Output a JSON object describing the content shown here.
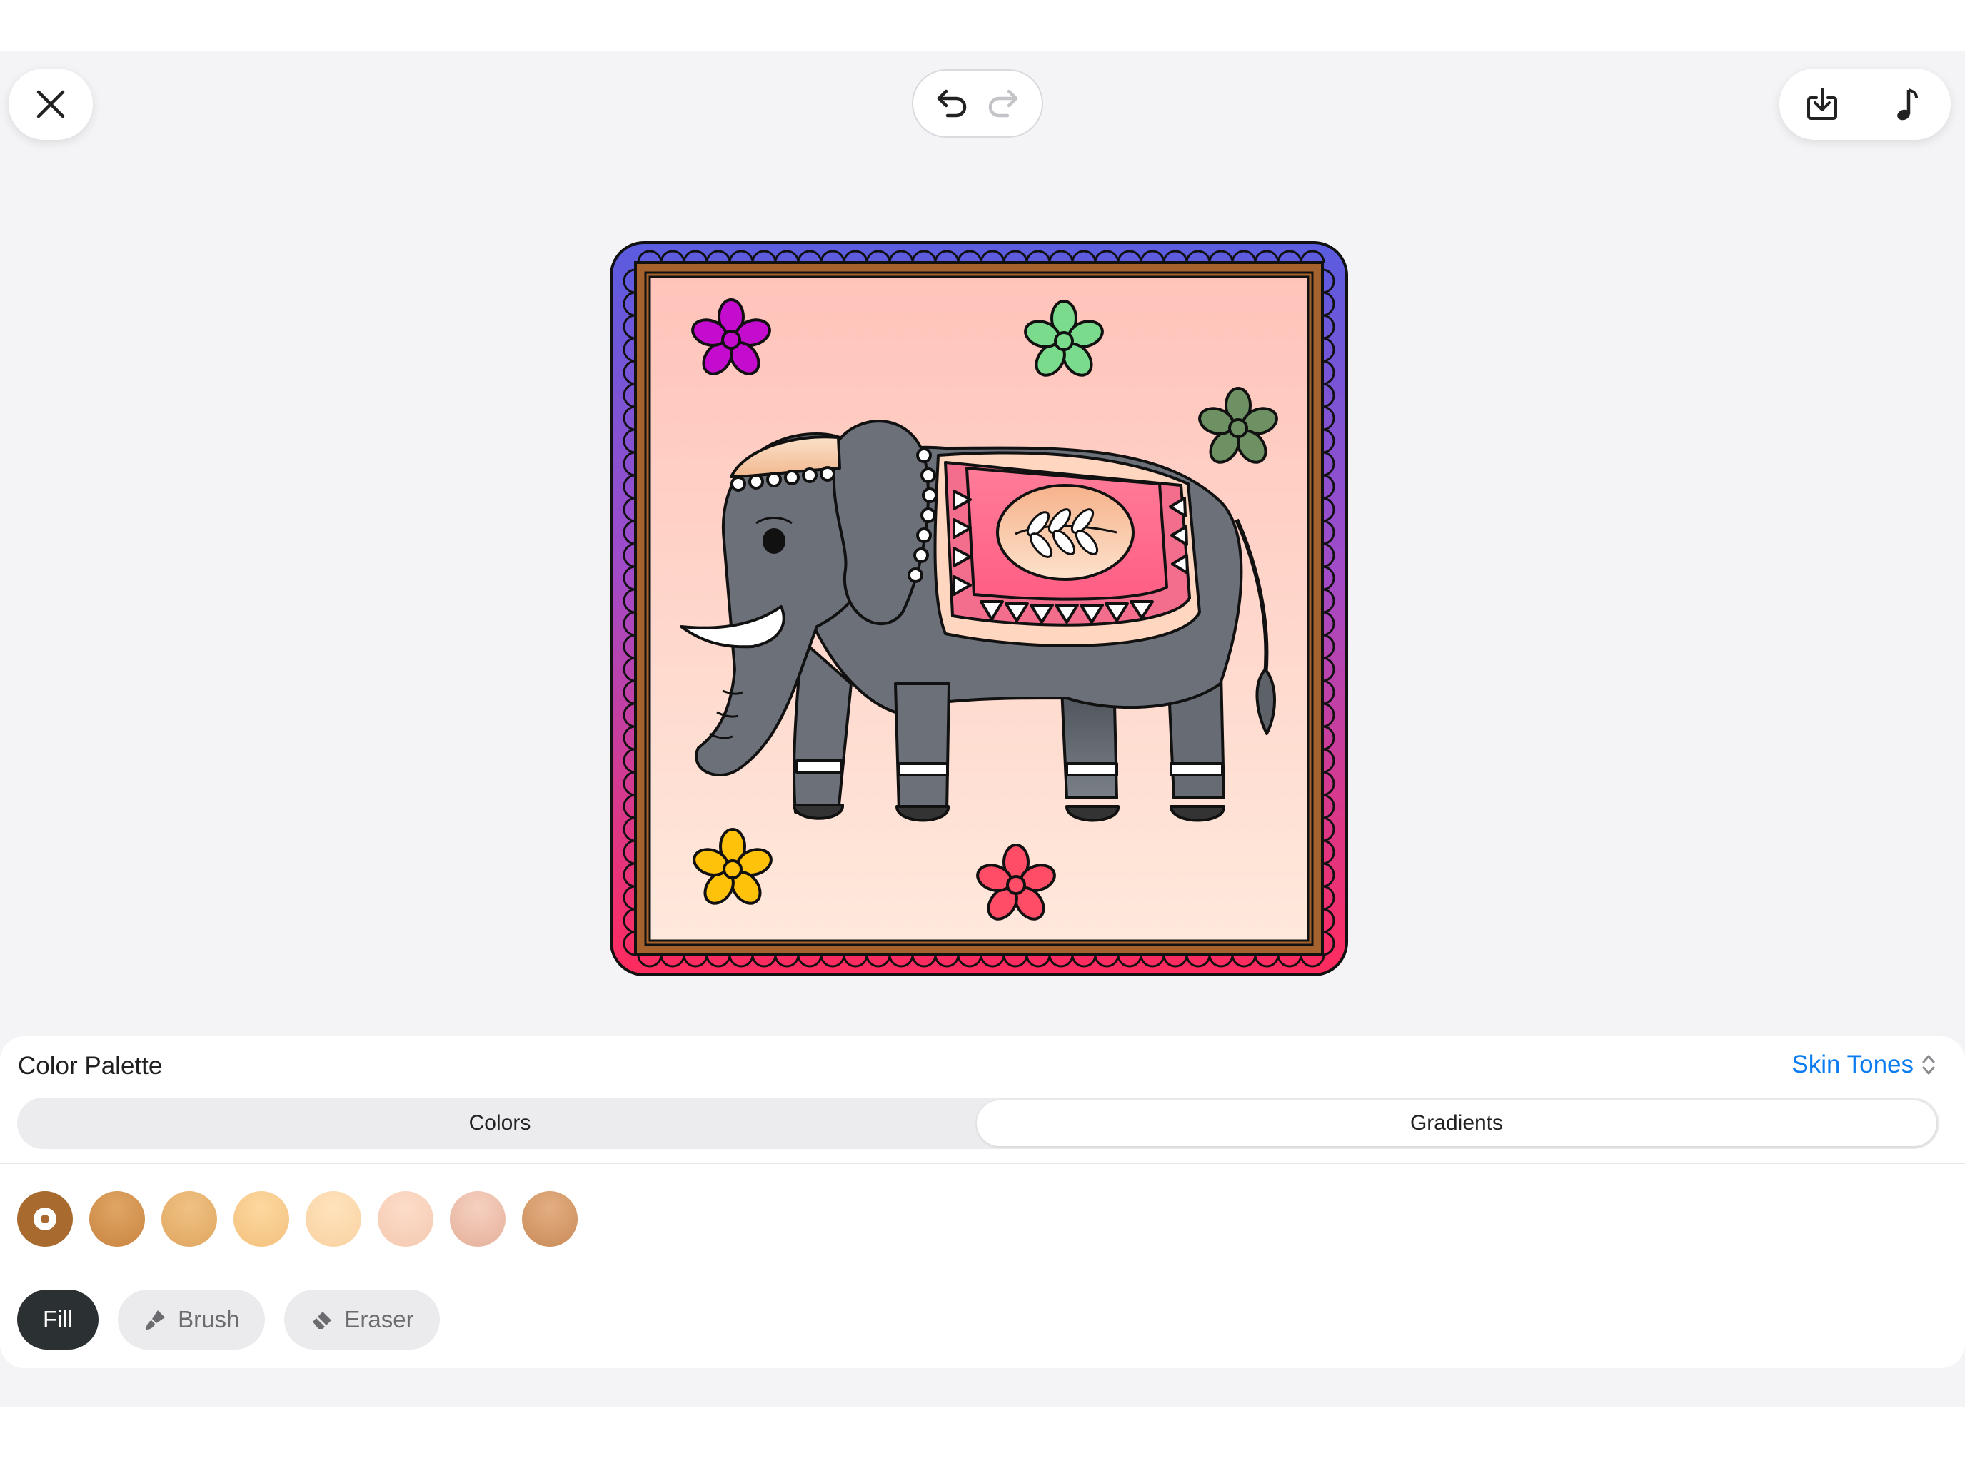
{
  "toolbar": {
    "close_icon": "close-icon",
    "undo_icon": "undo-icon",
    "redo_icon": "redo-icon",
    "download_icon": "download-icon",
    "music_icon": "music-note-icon"
  },
  "palette": {
    "title": "Color Palette",
    "selected_palette": "Skin Tones",
    "tabs": [
      {
        "label": "Colors",
        "active": false
      },
      {
        "label": "Gradients",
        "active": true
      }
    ],
    "swatches": [
      {
        "color": "#a86a2e",
        "selected": true
      },
      {
        "color": "#d4924f",
        "selected": false
      },
      {
        "color": "#e8b373",
        "selected": false
      },
      {
        "color": "#f7c98a",
        "selected": false
      },
      {
        "color": "#fbd8ae",
        "selected": false
      },
      {
        "color": "#f8d2bd",
        "selected": false
      },
      {
        "color": "#eec0ad",
        "selected": false
      },
      {
        "color": "#d59b6c",
        "selected": false
      }
    ]
  },
  "tools": {
    "fill_label": "Fill",
    "brush_label": "Brush",
    "eraser_label": "Eraser",
    "active_tool": "Fill"
  },
  "colors": {
    "accent": "#0a7cf0",
    "active_tool_bg": "#2b3133",
    "app_background": "#f4f4f6"
  }
}
